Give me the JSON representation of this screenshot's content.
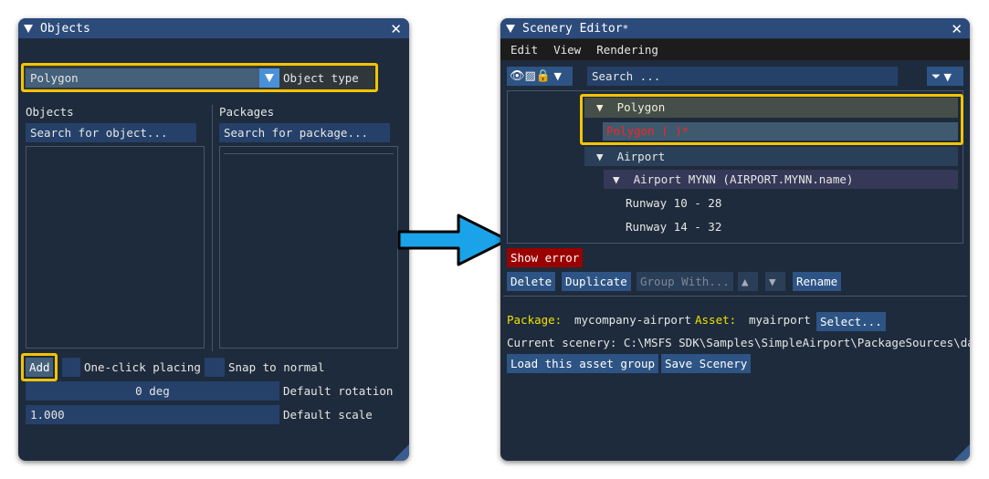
{
  "objects_window": {
    "title": "Objects",
    "object_type": {
      "value": "Polygon",
      "label": "Object type"
    },
    "objects_label": "Objects",
    "objects_search_placeholder": "Search for object...",
    "packages_label": "Packages",
    "packages_search_placeholder": "Search for package...",
    "add_button": "Add",
    "one_click_placing": "One-click placing",
    "snap_to_normal": "Snap to normal",
    "rotation": {
      "value": "0 deg",
      "label": "Default rotation"
    },
    "scale": {
      "value": "1.000",
      "label": "Default scale"
    }
  },
  "scenery_window": {
    "title": "Scenery Editor",
    "modified_mark": "*",
    "menu": [
      "Edit",
      "View",
      "Rendering"
    ],
    "search_placeholder": "Search ...",
    "tree": {
      "polygon_group": "Polygon",
      "polygon_item": "Polygon  ( )*",
      "airport_group": "Airport",
      "airport_item": "Airport MYNN (AIRPORT.MYNN.name)",
      "runways": [
        "Runway 10 - 28",
        "Runway 14 - 32"
      ]
    },
    "show_error": "Show error",
    "buttons": {
      "delete": "Delete",
      "duplicate": "Duplicate",
      "group_with": "Group With...",
      "rename": "Rename"
    },
    "package_label": "Package:",
    "package_value": "mycompany-airport",
    "asset_label": "Asset:",
    "asset_value": "myairport",
    "select_button": "Select...",
    "current_scenery": "Current scenery: C:\\MSFS SDK\\Samples\\SimpleAirport\\PackageSources\\data",
    "load_button": "Load this asset group",
    "save_button": "Save Scenery"
  },
  "colors": {
    "highlight": "#f5c400",
    "arrow": "#1aa3e8",
    "error": "#ff2020",
    "label_yellow": "#f0e000"
  }
}
